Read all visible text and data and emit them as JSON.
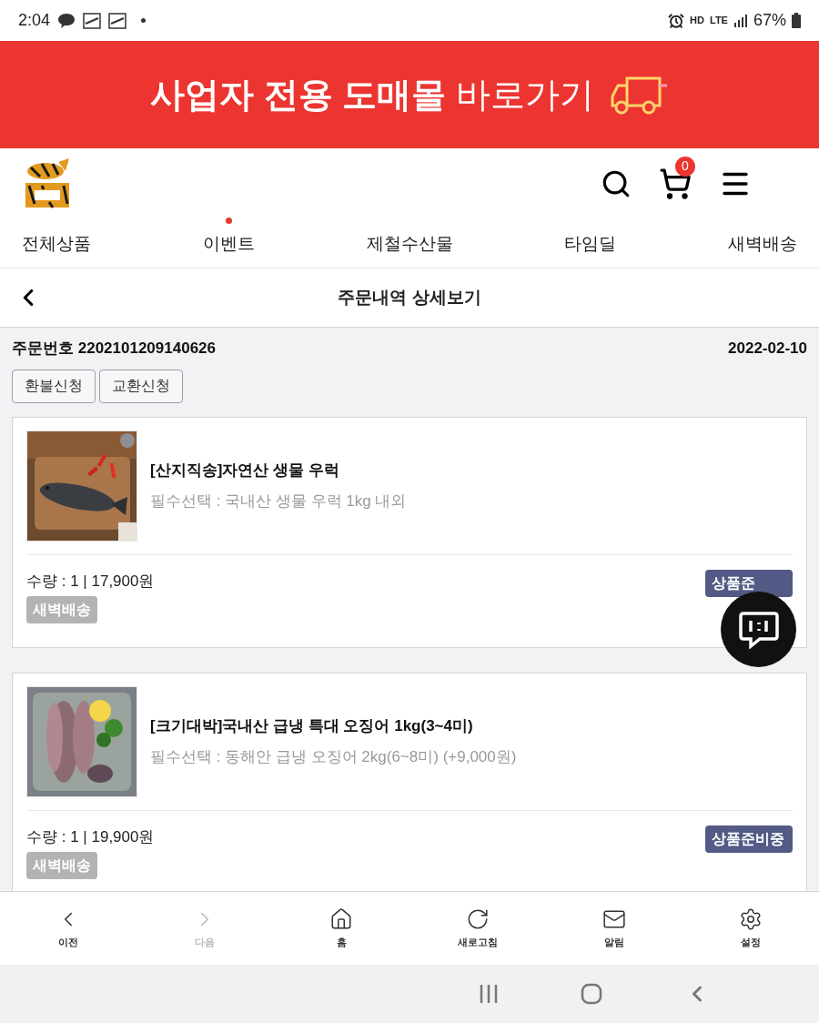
{
  "status_bar": {
    "time": "2:04",
    "network": [
      "HD",
      "LTE"
    ],
    "battery": "67%"
  },
  "banner": {
    "bold_text": "사업자 전용 도매몰",
    "text": "바로가기"
  },
  "header": {
    "cart_count": "0"
  },
  "tabs": [
    {
      "label": "전체상품",
      "has_dot": false
    },
    {
      "label": "이벤트",
      "has_dot": true
    },
    {
      "label": "제철수산물",
      "has_dot": false
    },
    {
      "label": "타임딜",
      "has_dot": false
    },
    {
      "label": "새벽배송",
      "has_dot": false
    }
  ],
  "page_title": "주문내역 상세보기",
  "order": {
    "number_label": "주문번호",
    "number": "2202101209140626",
    "date": "2022-02-10",
    "actions": [
      "환불신청",
      "교환신청"
    ],
    "items": [
      {
        "name": "[산지직송]자연산 생물 우럭",
        "option": "필수선택 : 국내산 생물 우럭 1kg 내외",
        "quantity": "수량 : 1 | 17,900원",
        "delivery": "새벽배송",
        "status": "상품준"
      },
      {
        "name": "[크기대박]국내산 급냉 특대 오징어 1kg(3~4미)",
        "option": "필수선택 : 동해안 급냉 오징어 2kg(6~8미) (+9,000원)",
        "quantity": "수량 : 1 | 19,900원",
        "delivery": "새벽배송",
        "status": "상품준비중"
      }
    ]
  },
  "bottom_nav": [
    {
      "label": "이전",
      "disabled": false
    },
    {
      "label": "다음",
      "disabled": true
    },
    {
      "label": "홈",
      "disabled": false
    },
    {
      "label": "새로고침",
      "disabled": false
    },
    {
      "label": "알림",
      "disabled": false
    },
    {
      "label": "설정",
      "disabled": false
    }
  ]
}
